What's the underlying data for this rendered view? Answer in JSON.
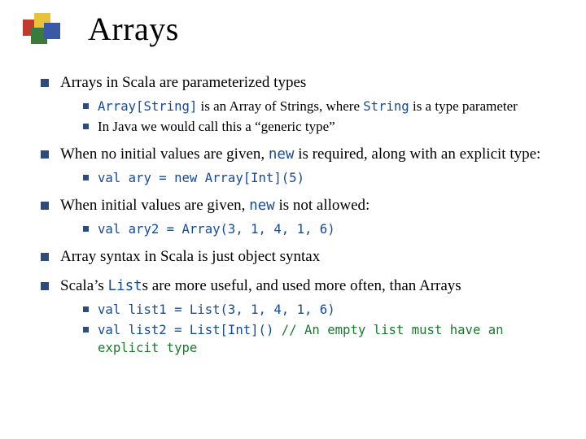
{
  "title": "Arrays",
  "b1": {
    "text": "Arrays in Scala are parameterized types",
    "sub": [
      {
        "c1": "Array[String]",
        "t1": " is an Array of Strings, where ",
        "c2": "String",
        "t2": " is a ",
        "t3": "type parameter"
      },
      {
        "t1": "In Java we would call this a “generic type”"
      }
    ]
  },
  "b2": {
    "t1": "When no initial values are given, ",
    "c1": "new",
    "t2": " is required, along with an explicit type:",
    "sub": [
      {
        "c1": "val ary = new Array[Int](5)"
      }
    ]
  },
  "b3": {
    "t1": "When initial values are given, ",
    "c1": "new",
    "t2": " is not allowed:",
    "sub": [
      {
        "c1": "val ary2 = Array(3, 1, 4, 1, 6)"
      }
    ]
  },
  "b4": {
    "t1": "Array syntax in Scala is just object syntax"
  },
  "b5": {
    "t1": "Scala’s ",
    "c1": "List",
    "t2": "s are more useful, and used more often, than Arrays",
    "sub": [
      {
        "c1": "val list1 = List(3, 1, 4, 1, 6)"
      },
      {
        "c1": "val list2 = List[Int]() ",
        "cm1": "// An empty list must have an explicit type"
      }
    ]
  }
}
